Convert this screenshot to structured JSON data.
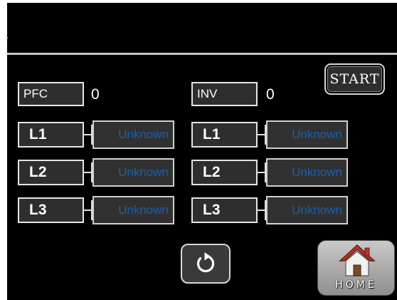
{
  "header": {
    "title": ""
  },
  "pfc": {
    "label": "PFC",
    "count": "0",
    "phases": [
      {
        "label": "L1",
        "status": "Unknown"
      },
      {
        "label": "L2",
        "status": "Unknown"
      },
      {
        "label": "L3",
        "status": "Unknown"
      }
    ]
  },
  "inv": {
    "label": "INV",
    "count": "0",
    "phases": [
      {
        "label": "L1",
        "status": "Unknown"
      },
      {
        "label": "L2",
        "status": "Unknown"
      },
      {
        "label": "L3",
        "status": "Unknown"
      }
    ]
  },
  "buttons": {
    "start_label": "START",
    "home_label": "HOME"
  },
  "icons": {
    "refresh": "refresh-icon",
    "home": "house-icon"
  },
  "colors": {
    "background": "#000000",
    "status_text": "#1c5fa8",
    "home_roof": "#b7352c"
  }
}
